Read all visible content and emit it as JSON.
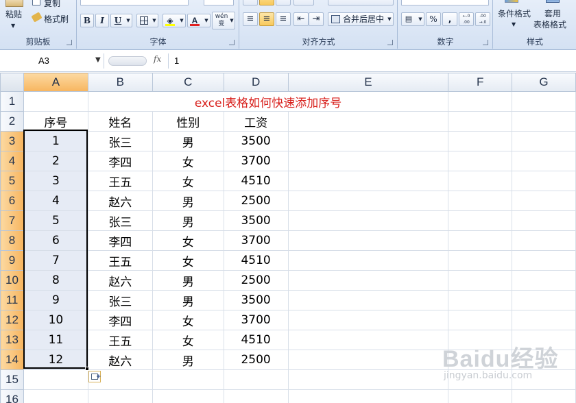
{
  "ribbon": {
    "clipboard": {
      "paste_label": "粘贴",
      "copy_label": "复制",
      "format_painter_label": "格式刷",
      "group_label": "剪贴板"
    },
    "font": {
      "group_label": "字体",
      "bold": "B",
      "italic": "I",
      "underline": "U",
      "wen_button": "wén 变"
    },
    "alignment": {
      "group_label": "对齐方式",
      "merge_center_label": "合并后居中"
    },
    "number": {
      "group_label": "数字",
      "percent": "%",
      "comma": ",",
      "increase_decimal": "←.0 .00",
      "decrease_decimal": ".00 →.0"
    },
    "styles": {
      "conditional_format_label": "条件格式",
      "table_format_label_1": "套用",
      "table_format_label_2": "表格格式",
      "group_label": "样式"
    }
  },
  "formula_bar": {
    "name_box": "A3",
    "fx": "fx",
    "value": "1"
  },
  "sheet": {
    "columns": [
      "A",
      "B",
      "C",
      "D",
      "E",
      "F",
      "G"
    ],
    "selected_column": "A",
    "title": "excel表格如何快速添加序号",
    "headers": [
      "序号",
      "姓名",
      "性别",
      "工资"
    ],
    "rows": [
      [
        "1",
        "张三",
        "男",
        "3500"
      ],
      [
        "2",
        "李四",
        "女",
        "3700"
      ],
      [
        "3",
        "王五",
        "女",
        "4510"
      ],
      [
        "4",
        "赵六",
        "男",
        "2500"
      ],
      [
        "5",
        "张三",
        "男",
        "3500"
      ],
      [
        "6",
        "李四",
        "女",
        "3700"
      ],
      [
        "7",
        "王五",
        "女",
        "4510"
      ],
      [
        "8",
        "赵六",
        "男",
        "2500"
      ],
      [
        "9",
        "张三",
        "男",
        "3500"
      ],
      [
        "10",
        "李四",
        "女",
        "3700"
      ],
      [
        "11",
        "王五",
        "女",
        "4510"
      ],
      [
        "12",
        "赵六",
        "男",
        "2500"
      ]
    ],
    "row_numbers": [
      "1",
      "2",
      "3",
      "4",
      "5",
      "6",
      "7",
      "8",
      "9",
      "10",
      "11",
      "12",
      "13",
      "14",
      "15",
      "16"
    ]
  },
  "watermark": {
    "brand": "Baidu经验",
    "url": "jingyan.baidu.com"
  },
  "colors": {
    "title_red": "#d8211d",
    "selected_header_orange": "#f7b55f",
    "selected_range_fill": "#e6ebf5"
  }
}
